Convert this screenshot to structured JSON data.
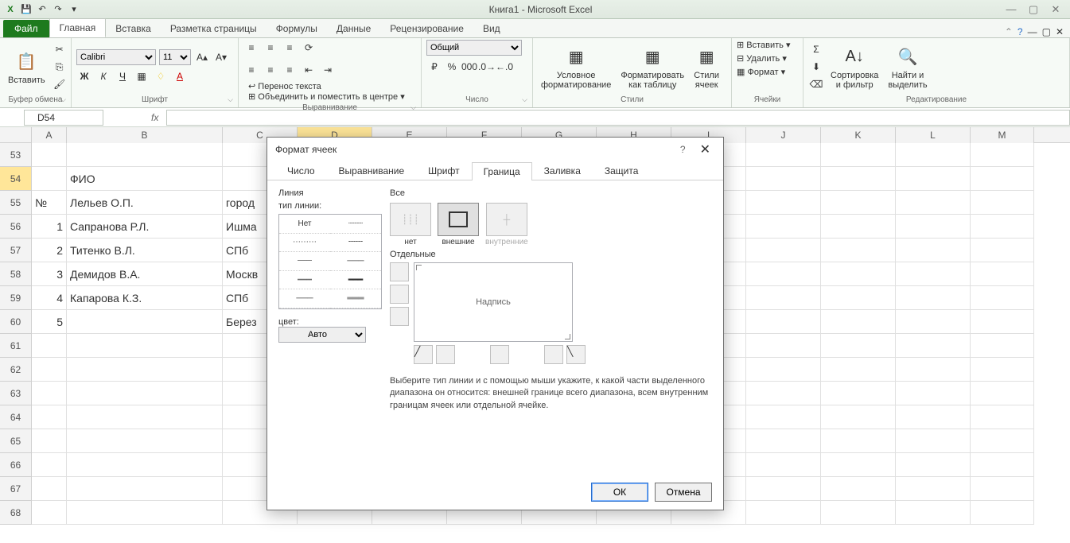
{
  "app": {
    "title": "Книга1  -  Microsoft Excel"
  },
  "qat": {
    "excel_icon": "X",
    "save_icon": "💾",
    "undo_icon": "↶",
    "redo_icon": "↷"
  },
  "tabs": {
    "file": "Файл",
    "items": [
      "Главная",
      "Вставка",
      "Разметка страницы",
      "Формулы",
      "Данные",
      "Рецензирование",
      "Вид"
    ],
    "active": 0
  },
  "ribbon": {
    "clipboard": {
      "paste": "Вставить",
      "label": "Буфер обмена"
    },
    "font": {
      "name": "Calibri",
      "size": "11",
      "label": "Шрифт"
    },
    "alignment": {
      "wrap": "Перенос текста",
      "merge": "Объединить и поместить в центре",
      "label": "Выравнивание"
    },
    "number": {
      "format": "Общий",
      "label": "Число"
    },
    "styles": {
      "conditional": "Условное\nформатирование",
      "table": "Форматировать\nкак таблицу",
      "cell": "Стили\nячеек",
      "label": "Стили"
    },
    "cells": {
      "insert": "Вставить",
      "delete": "Удалить",
      "format": "Формат",
      "label": "Ячейки"
    },
    "editing": {
      "sort": "Сортировка\nи фильтр",
      "find": "Найти и\nвыделить",
      "label": "Редактирование"
    }
  },
  "namebox": "D54",
  "columns": [
    "A",
    "B",
    "C",
    "D",
    "E",
    "F",
    "G",
    "H",
    "I",
    "J",
    "K",
    "L",
    "M"
  ],
  "active_col": "D",
  "rows": [
    53,
    54,
    55,
    56,
    57,
    58,
    59,
    60,
    61,
    62,
    63,
    64,
    65,
    66,
    67,
    68
  ],
  "active_row": 54,
  "cell_data": {
    "54": {
      "B": "ФИО"
    },
    "55": {
      "A": "№",
      "B": "Лельев О.П.",
      "C": "город"
    },
    "56": {
      "A": "1",
      "B": "Сапранова Р.Л.",
      "C": "Ишма"
    },
    "57": {
      "A": "2",
      "B": "Титенко В.Л.",
      "C": "СПб"
    },
    "58": {
      "A": "3",
      "B": "Демидов В.А.",
      "C": "Москв"
    },
    "59": {
      "A": "4",
      "B": "Капарова К.З.",
      "C": "СПб"
    },
    "60": {
      "A": "5",
      "C": "Берез"
    }
  },
  "dialog": {
    "title": "Формат ячеек",
    "tabs": [
      "Число",
      "Выравнивание",
      "Шрифт",
      "Граница",
      "Заливка",
      "Защита"
    ],
    "active_tab": 3,
    "line_section": "Линия",
    "line_type_label": "тип линии:",
    "line_none": "Нет",
    "color_label": "цвет:",
    "color_value": "Авто",
    "all_section": "Все",
    "presets": [
      {
        "label": "нет",
        "selected": false
      },
      {
        "label": "внешние",
        "selected": true
      },
      {
        "label": "внутренние",
        "selected": false
      }
    ],
    "individual_section": "Отдельные",
    "preview_text": "Надпись",
    "hint": "Выберите тип линии и с помощью мыши укажите, к какой части выделенного диапазона он относится: внешней границе всего диапазона, всем внутренним границам ячеек или отдельной ячейке.",
    "ok": "ОК",
    "cancel": "Отмена"
  }
}
